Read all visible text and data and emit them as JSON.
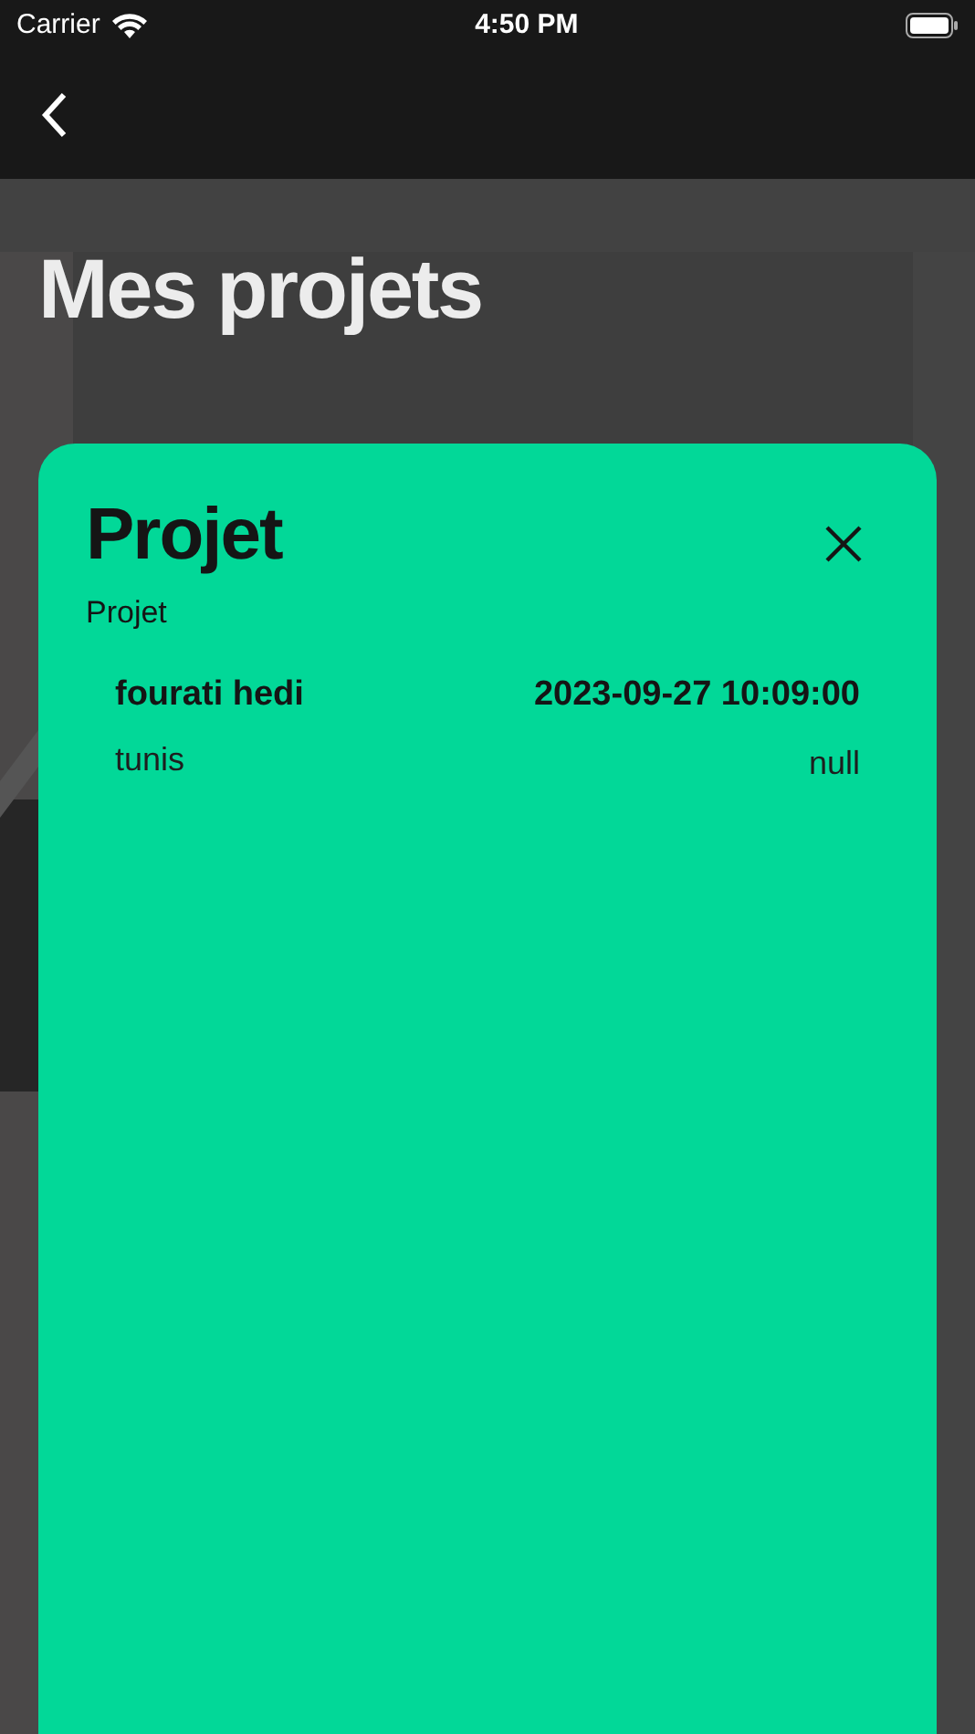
{
  "status_bar": {
    "carrier": "Carrier",
    "time": "4:50 PM"
  },
  "nav": {
    "title": "Mes projets"
  },
  "dialog": {
    "title": "Projet",
    "subtitle": "Projet",
    "items": [
      {
        "name": "fourati hedi",
        "date": "2023-09-27 10:09:00",
        "place": "tunis",
        "value": "null"
      }
    ]
  }
}
